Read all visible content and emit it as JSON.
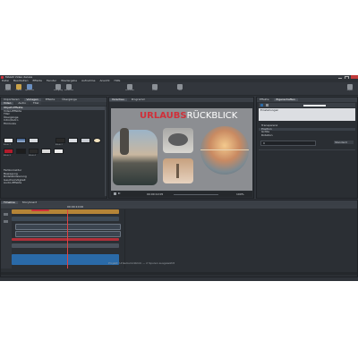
{
  "window": {
    "title": "MAGIX Video deluxe"
  },
  "menu": [
    "Datei",
    "Bearbeiten",
    "Effekte",
    "Fenster",
    "Wiedergabe",
    "Aufnahme",
    "Ansicht",
    "Hilfe"
  ],
  "toolbar": {
    "buttons": [
      {
        "label": "Import",
        "icon": "import-icon"
      },
      {
        "label": "Ordner",
        "icon": "folder-icon"
      },
      {
        "label": "Speichern",
        "icon": "save-icon"
      },
      {
        "label": "Rückgängig",
        "icon": "undo-icon"
      },
      {
        "label": "Wiederholen",
        "icon": "redo-icon"
      },
      {
        "label": "Schneiden",
        "icon": "cut-icon"
      },
      {
        "label": "Zoom",
        "icon": "zoom-icon"
      },
      {
        "label": "Titel",
        "icon": "title-icon"
      },
      {
        "label": "Export",
        "icon": "export-icon"
      }
    ]
  },
  "left_panel": {
    "tabs": [
      "Importieren",
      "Vorlagen",
      "Effekte",
      "Übergänge"
    ],
    "subtabs": [
      "Video",
      "Audio",
      "Titel"
    ],
    "categories": [
      "Objekt-Effekte",
      "Video-Effekte",
      "Titel",
      "Übergänge",
      "Intro/Outro",
      "Filmlooks"
    ],
    "selected_category": "Objekt-Effekte",
    "bottom_items": [
      "Farbkorrektur",
      "Bewegung",
      "Bildstabilisierung",
      "Geschwindigkeit",
      "Audio-Effekte"
    ],
    "thumb_labels": [
      "Effekt 1",
      "Effekt 2",
      "Effekt 3",
      "Effekt 4",
      "Effekt 5",
      "Effekt 6"
    ]
  },
  "preview": {
    "tabs": [
      "Vorschau",
      "Programm"
    ],
    "title_text_red": "URLAUBS",
    "title_text_white": "RÜCKBLICK",
    "timecode": "00:00:12:05",
    "zoom_level": "100%"
  },
  "right_panel": {
    "tabs": [
      "Effekte",
      "Eigenschaften"
    ],
    "section_title": "Einstellungen",
    "rows": [
      "Transparenz",
      "Position",
      "Größe",
      "Rotation"
    ],
    "value_field": "0",
    "dropdown_value": "Standard"
  },
  "timeline": {
    "tabs": [
      "Timeline",
      "Storyboard"
    ],
    "ruler_time": "00:00:10:00",
    "status_text": "Projekt: Urlaubsrückblick — 2 Spuren ausgewählt"
  },
  "colors": {
    "accent_red": "#d0303a",
    "track_orange": "#b48437",
    "track_blue": "#2a6aa8",
    "bg": "#2f3339"
  }
}
